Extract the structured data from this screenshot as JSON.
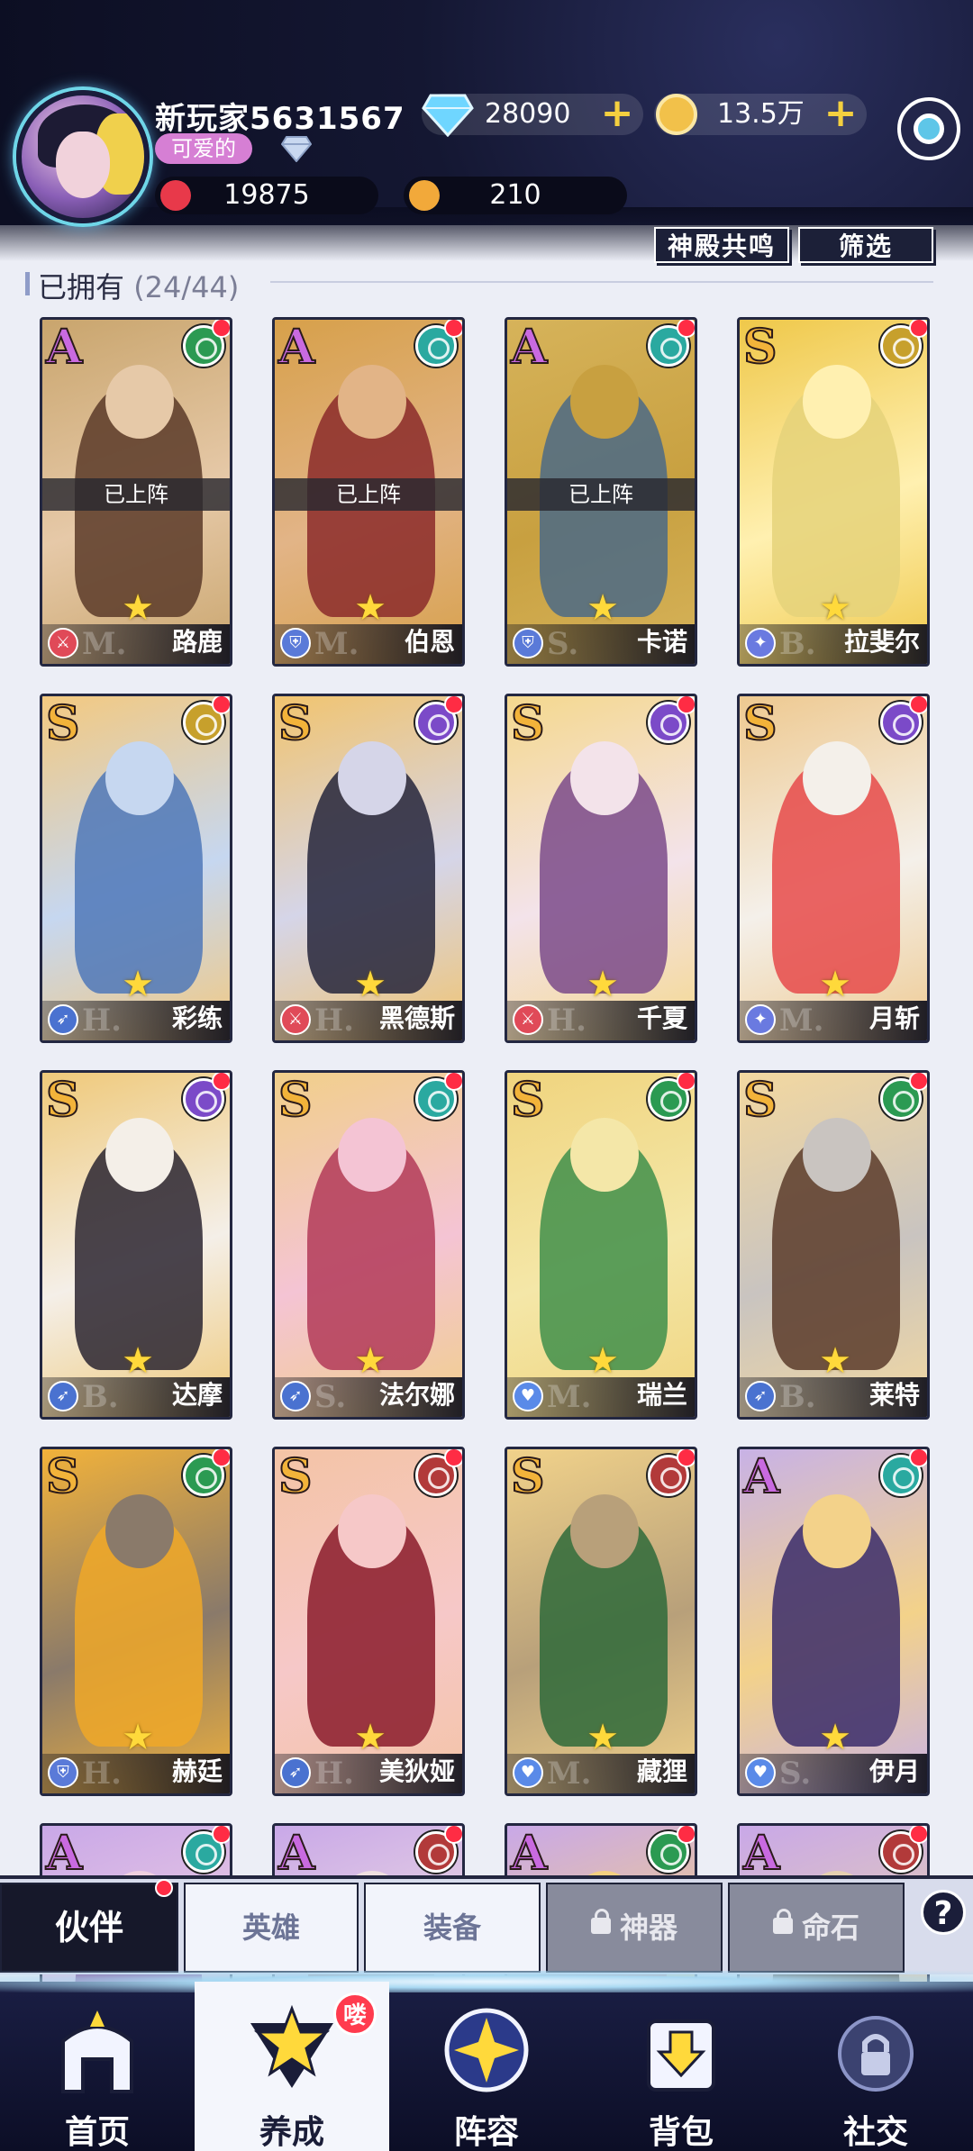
{
  "player": {
    "name": "新玩家5631567",
    "title": "可爱的",
    "power": "19875",
    "level": "210"
  },
  "currency": {
    "diamonds": "28090",
    "gold": "13.5万"
  },
  "buttons": {
    "resonance": "神殿共鸣",
    "filter": "筛选"
  },
  "section": {
    "title": "已拥有",
    "count": "(24/44)"
  },
  "colors": {
    "grade_A": "#c96ae0",
    "grade_S": "#f2b33a",
    "elem_teal": "#2aa9a0",
    "elem_green": "#2b9a52",
    "elem_gold": "#c7a02c",
    "elem_purple": "#7b4ac8",
    "elem_red": "#b23a3a",
    "accent_red_dot": "#ff2c44"
  },
  "cards": [
    {
      "grade": "A",
      "name": "路鹿",
      "deployed": "已上阵",
      "role": "sword-icon",
      "tag": "M."
    },
    {
      "grade": "A",
      "name": "伯恩",
      "deployed": "已上阵",
      "role": "shield-icon",
      "tag": "M."
    },
    {
      "grade": "A",
      "name": "卡诺",
      "deployed": "已上阵",
      "role": "shield-icon",
      "tag": "S."
    },
    {
      "grade": "S",
      "name": "拉斐尔",
      "deployed": "",
      "role": "staff-icon",
      "tag": "B."
    },
    {
      "grade": "S",
      "name": "彩练",
      "deployed": "",
      "role": "bow-icon",
      "tag": "H."
    },
    {
      "grade": "S",
      "name": "黑德斯",
      "deployed": "",
      "role": "sword-icon",
      "tag": "H."
    },
    {
      "grade": "S",
      "name": "千夏",
      "deployed": "",
      "role": "sword-icon",
      "tag": "H."
    },
    {
      "grade": "S",
      "name": "月斩",
      "deployed": "",
      "role": "staff-icon",
      "tag": "M."
    },
    {
      "grade": "S",
      "name": "达摩",
      "deployed": "",
      "role": "bow-icon",
      "tag": "B."
    },
    {
      "grade": "S",
      "name": "法尔娜",
      "deployed": "",
      "role": "bow-icon",
      "tag": "S."
    },
    {
      "grade": "S",
      "name": "瑞兰",
      "deployed": "",
      "role": "heart-icon",
      "tag": "M."
    },
    {
      "grade": "S",
      "name": "莱特",
      "deployed": "",
      "role": "bow-icon",
      "tag": "B."
    },
    {
      "grade": "S",
      "name": "赫廷",
      "deployed": "",
      "role": "shield-icon",
      "tag": "H."
    },
    {
      "grade": "S",
      "name": "美狄娅",
      "deployed": "",
      "role": "bow-icon",
      "tag": "H."
    },
    {
      "grade": "S",
      "name": "藏狸",
      "deployed": "",
      "role": "heart-icon",
      "tag": "M."
    },
    {
      "grade": "A",
      "name": "伊月",
      "deployed": "",
      "role": "heart-icon",
      "tag": "S."
    },
    {
      "grade": "A",
      "name": "",
      "deployed": "",
      "role": "",
      "tag": ""
    },
    {
      "grade": "A",
      "name": "",
      "deployed": "",
      "role": "",
      "tag": ""
    },
    {
      "grade": "A",
      "name": "",
      "deployed": "",
      "role": "",
      "tag": ""
    },
    {
      "grade": "A",
      "name": "",
      "deployed": "",
      "role": "",
      "tag": ""
    }
  ],
  "tabs": {
    "partner": "伙伴",
    "hero": "英雄",
    "equipment": "装备",
    "artifact": "神器",
    "fate": "命石",
    "help": "?"
  },
  "nav": {
    "home": "首页",
    "develop": "养成",
    "lineup": "阵容",
    "bag": "背包",
    "social": "社交",
    "badge": "喽"
  }
}
